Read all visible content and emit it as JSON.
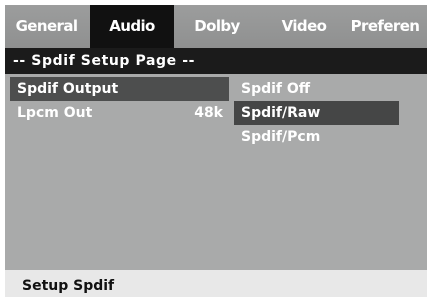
{
  "tabs": [
    {
      "label": "General",
      "active": false
    },
    {
      "label": "Audio",
      "active": true
    },
    {
      "label": "Dolby",
      "active": false
    },
    {
      "label": "Video",
      "active": false
    },
    {
      "label": "Preferen",
      "active": false
    }
  ],
  "page_title": "-- Spdif Setup Page --",
  "settings": [
    {
      "label": "Spdif Output",
      "value": "",
      "selected": true
    },
    {
      "label": "Lpcm Out",
      "value": "48k",
      "selected": false
    }
  ],
  "options": [
    {
      "label": "Spdif Off",
      "highlighted": false
    },
    {
      "label": "Spdif/Raw",
      "highlighted": true
    },
    {
      "label": "Spdif/Pcm",
      "highlighted": false
    }
  ],
  "status": "Setup Spdif",
  "colors": {
    "menu_background": "#a9aaaa",
    "active_tab": "#111111",
    "title_bar": "#1b1b1b",
    "selection": "#4d4e4e",
    "status_bar": "#e8e8e8"
  }
}
